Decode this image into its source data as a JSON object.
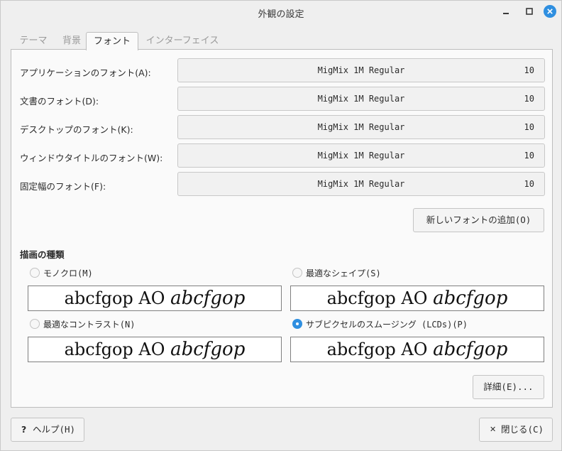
{
  "window": {
    "title": "外観の設定"
  },
  "tabs": [
    {
      "label": "テーマ"
    },
    {
      "label": "背景"
    },
    {
      "label": "フォント"
    },
    {
      "label": "インターフェイス"
    }
  ],
  "fonts": [
    {
      "label": "アプリケーションのフォント(A):",
      "font": "MigMix 1M Regular",
      "size": "10"
    },
    {
      "label": "文書のフォント(D):",
      "font": "MigMix 1M Regular",
      "size": "10"
    },
    {
      "label": "デスクトップのフォント(K):",
      "font": "MigMix 1M Regular",
      "size": "10"
    },
    {
      "label": "ウィンドウタイトルのフォント(W):",
      "font": "MigMix 1M Regular",
      "size": "10"
    },
    {
      "label": "固定幅のフォント(F):",
      "font": "MigMix 1M Regular",
      "size": "10"
    }
  ],
  "add_font_button": "新しいフォントの追加(O)",
  "rendering": {
    "title": "描画の種類",
    "options": [
      {
        "label": "モノクロ(M)",
        "selected": false,
        "preview_regular": "abcfgop AO",
        "preview_italic": "abcfgop"
      },
      {
        "label": "最適なシェイプ(S)",
        "selected": false,
        "preview_regular": "abcfgop AO",
        "preview_italic": "abcfgop"
      },
      {
        "label": "最適なコントラスト(N)",
        "selected": false,
        "preview_regular": "abcfgop AO",
        "preview_italic": "abcfgop"
      },
      {
        "label": "サブピクセルのスムージング (LCDs)(P)",
        "selected": true,
        "preview_regular": "abcfgop AO",
        "preview_italic": "abcfgop"
      }
    ]
  },
  "details_button": "詳細(E)...",
  "help_button": {
    "icon": "?",
    "label": "ヘルプ(H)"
  },
  "close_button": {
    "icon": "✕",
    "label": "閉じる(C)"
  },
  "colors": {
    "accent": "#2f8fe0",
    "close_icon_bg": "#2f8fe0"
  }
}
